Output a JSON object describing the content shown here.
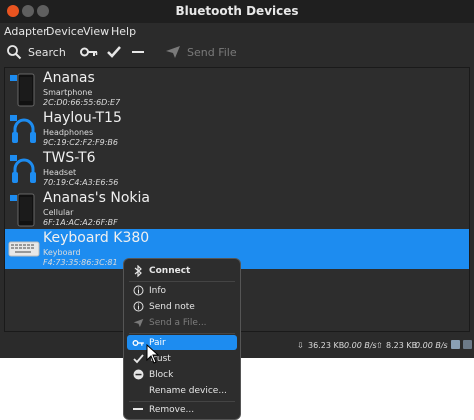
{
  "window": {
    "title": "Bluetooth Devices"
  },
  "menubar": [
    "Adapter",
    "Device",
    "View",
    "Help"
  ],
  "toolbar": {
    "search": "Search",
    "send_file": "Send File"
  },
  "devices": [
    {
      "name": "Ananas",
      "type": "Smartphone",
      "address": "2C:D0:66:55:6D:E7",
      "icon": "smartphone-icon"
    },
    {
      "name": "Haylou-T15",
      "type": "Headphones",
      "address": "9C:19:C2:F2:F9:B6",
      "icon": "headphones-icon"
    },
    {
      "name": "TWS-T6",
      "type": "Headset",
      "address": "70:19:C4:A3:E6:56",
      "icon": "headphones-icon"
    },
    {
      "name": "Ananas's Nokia",
      "type": "Cellular",
      "address": "6F:1A:AC:A2:6F:BF",
      "icon": "cellphone-icon"
    },
    {
      "name": "Keyboard K380",
      "type": "Keyboard",
      "address": "F4:73:35:86:3C:81",
      "icon": "keyboard-icon",
      "selected": true
    }
  ],
  "status": {
    "down_total": "36.23 KB",
    "down_rate": "0.00 B/s",
    "up_total": "8.23 KB",
    "up_rate": "0.00 B/s"
  },
  "context_menu": {
    "connect": "Connect",
    "info": "Info",
    "send_note": "Send note",
    "send_file": "Send a File...",
    "pair": "Pair",
    "trust": "Trust",
    "block": "Block",
    "rename": "Rename device...",
    "remove": "Remove..."
  },
  "colors": {
    "accent": "#1d8cf0",
    "close_button": "#e95420"
  }
}
